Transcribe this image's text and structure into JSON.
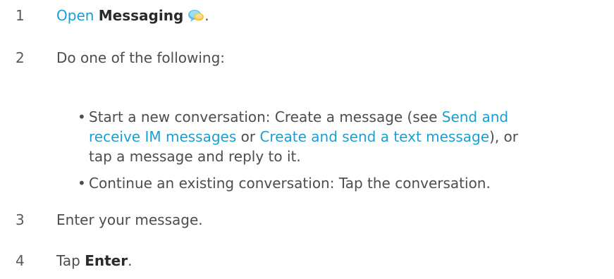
{
  "steps": [
    {
      "number": "1",
      "prefix_link": "Open",
      "bold": "Messaging",
      "suffix": ".",
      "icon": "messaging-icon"
    },
    {
      "number": "2",
      "text": "Do one of the following:"
    },
    {
      "number": "3",
      "text": "Enter your message."
    },
    {
      "number": "4",
      "prefix": "Tap ",
      "bold": "Enter",
      "suffix": "."
    }
  ],
  "bullets": [
    {
      "bullet": "•",
      "label": "Start a new conversation:",
      "text_before": " Create a message (see ",
      "link1": "Send and receive IM messages",
      "text_middle": " or ",
      "link2": "Create and send a text message",
      "text_after": "), or tap a message and reply to it."
    },
    {
      "bullet": "•",
      "label": "Continue an existing conversation:",
      "text": " Tap the conversation."
    }
  ],
  "colors": {
    "link": "#1a9fd0",
    "text": "#4d4d4f"
  }
}
